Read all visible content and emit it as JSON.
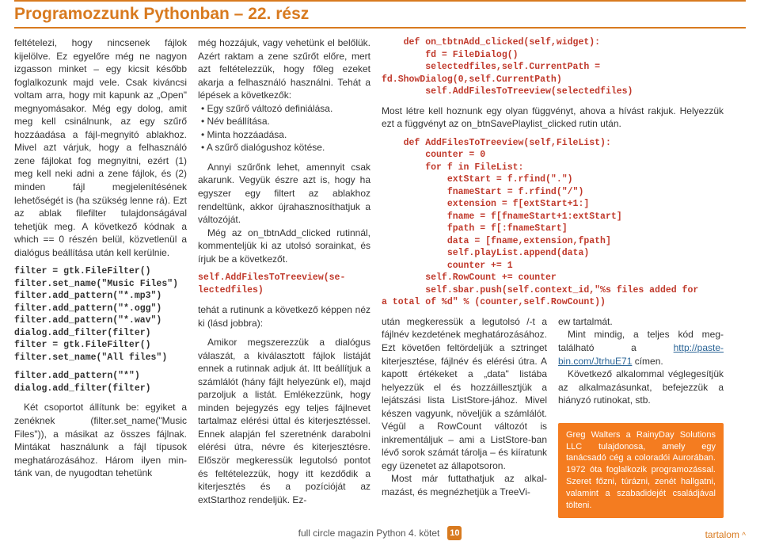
{
  "header": {
    "title": "Programozzunk Pythonban – 22. rész"
  },
  "col1": {
    "p1": "feltételezi, hogy nincsenek fájlok kijelölve. Ez egyelőre még ne na­gyon izgasson minket – egy kicsit később foglalkozunk majd vele. Csak kiváncsi voltam arra, hogy mit kapunk az „Open\" megnyomása­kor. Még egy dolog, amit meg kell csinálnunk, az egy szűrő hozzáadá­sa a fájl-megnyitó ablakhoz. Mivel azt várjuk, hogy a felhasználó zene fájlokat fog megnyitni, ezért (1) meg kell neki adni a zene fájlok, és (2) minden fájl megjelenítésének lehetőségét is (ha szükség lenne rá). Ezt az ablak filefilter tulajdon­ságával tehetjük meg. A következő kódnak a which == 0 részén belül, közvetlenül a dialógus beállítása után kell kerülnie.",
    "code1": "filter = gtk.FileFilter()\nfilter.set_name(\"Music Files\")\nfilter.add_pattern(\"*.mp3\")\nfilter.add_pattern(\"*.ogg\")\nfilter.add_pattern(\"*.wav\")\ndialog.add_filter(filter)\nfilter = gtk.FileFilter()\nfilter.set_name(\"All files\")",
    "code2": "filter.add_pattern(\"*\")\ndialog.add_filter(filter)",
    "p2": "Két csoportot állítunk be: egyiket a zenéknek (filter.set_name(\"Music Files\")), a másikat az összes fájlnak. Mintákat használunk a fájl típusok meghatározásához. Három ilyen min­tánk van, de nyugodtan tehetünk"
  },
  "col2": {
    "p1": "még hozzájuk, vagy vehetünk el belő­lük. Azért raktam a zene szűrőt előre, mert azt feltételezzük, hogy főleg ezeket akarja a felhasználó használni. Tehát a lépések a következők:",
    "bullets": [
      "Egy szűrő változó definiálása.",
      "Név beállítása.",
      "Minta hozzáadása.",
      "A szűrő dialógushoz kötése."
    ],
    "p2": "Annyi szűrőnk lehet, amennyit csak akarunk. Vegyük észre azt is, hogy ha egyszer egy filtert az ab­lakhoz rendeltünk, akkor újrahasz­nosíthatjuk a változóját.",
    "p3": "Még az on_tbtnAdd_clicked ru­tinnál, kommenteljük ki az utolsó sorainkat, és írjuk be a következőt.",
    "code1": "self.AddFilesToTreeview(se­lectedfiles)",
    "p4": "tehát a rutinunk a következő kép­pen néz ki (lásd jobbra):",
    "p5": "Amikor megszerezzük a dialógus válaszát, a kiválasztott fájlok listáját ennek a rutinnak adjuk át. Itt beállít­juk a számlálót (hány fájlt helyezünk el), majd parzoljuk a listát. Emlékez­zünk, hogy minden bejegyzés egy tel­jes fájlnevet tartalmaz elérési úttal és kiterjesztéssel. Ennek alapján fel sze­retnénk darabolni elérési útra, névre és kiterjesztésre. Először megkeres­sük legutolsó pontot és feltételezzük, hogy itt kezdődik a kiterjesztés és a pozícióját az extStarthoz rendeljük. Ez-"
  },
  "col3": {
    "code1": "    def on_tbtnAdd_clicked(self,widget):\n        fd = FileDialog()\n        selectedfiles,self.CurrentPath =\nfd.ShowDialog(0,self.CurrentPath)\n        self.AddFilesToTreeview(selectedfiles)",
    "p1": "Most létre kell hoznunk egy olyan függvényt, ahova a hívást rakjuk. Helyezzük ezt a függvényt az on_btnSavePlaylist_clicked rutin után.",
    "code2": "    def AddFilesToTreeview(self,FileList):\n        counter = 0\n        for f in FileList:\n            extStart = f.rfind(\".\")\n            fnameStart = f.rfind(\"/\")\n            extension = f[extStart+1:]\n            fname = f[fnameStart+1:extStart]\n            fpath = f[:fnameStart]\n            data = [fname,extension,fpath]\n            self.playList.append(data)\n            counter += 1\n        self.RowCount += counter\n        self.sbar.push(self.context_id,\"%s files added for\na total of %d\" % (counter,self.RowCount))",
    "sc1": {
      "p1": "után megkeressük a legutolsó /-t a fájlnév kezdetének meghatározásá­hoz. Ezt követően feltördeljük a sztringet kiterjesztése, fájlnév és el­érési útra. A kapott értékeket a „da­ta\" listába helyezzük el és hozzáillesztjük a lejátszási lista List­Store-jához. Mivel készen vagyunk, növeljük a számlálót. Végül a Row­Count változót is inkrementáljuk – ami a ListStore-ban lévő sorok számát tárolja – és kiíratunk egy üzenetet az állapotsoron.",
      "p2": "Most már futtathatjuk az alkal­mazást, és megnézhetjük a TreeVi-"
    },
    "sc2": {
      "p1": "ew tartalmát.",
      "p2a": "Mint mindig, a teljes kód meg­található a ",
      "link": "http://paste­bin.com/JtrhuE71",
      "p2b": " címen.",
      "p3": "Következő alkalommal végle­gesítjük az alkalmazásunkat, befe­jezzük a hiányzó rutinokat, stb."
    },
    "author": "Greg Walters a RainyDay Solutions LLC tulajdonosa, amely egy tanácsadó cég a coloradói Aurorában. 1972 óta foglalkozik programozással. Szeret főzni, túrázni, zenét hallgatni, valamint a szabadidejét családjával tölteni."
  },
  "footer": {
    "left": "full circle magazin Python 4. kötet",
    "page": "10",
    "toc": "tartalom",
    "caret": "^"
  }
}
